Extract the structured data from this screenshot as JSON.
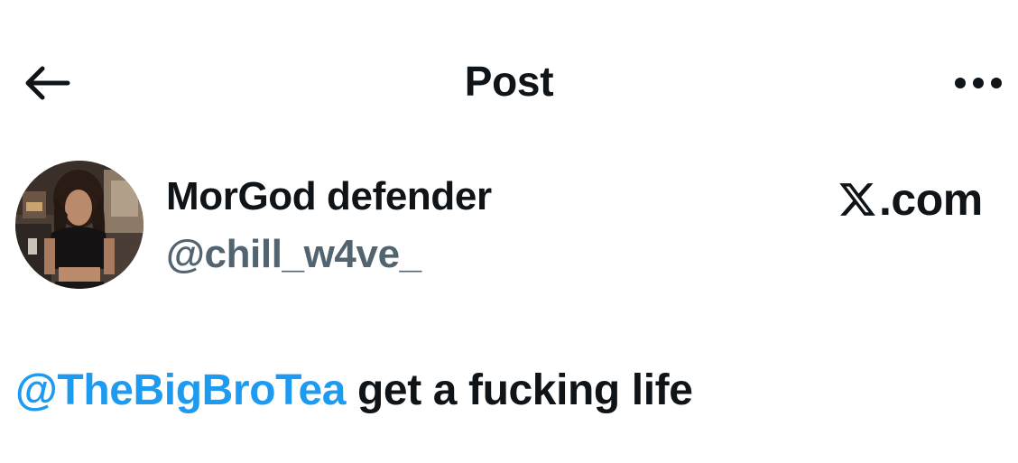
{
  "header": {
    "title": "Post",
    "back_icon": "arrow-left-icon",
    "more_icon": "more-horizontal-icon"
  },
  "author": {
    "display_name": "MorGod defender",
    "handle": "@chill_w4ve_",
    "avatar_icon": "avatar-photo"
  },
  "brand": {
    "logo_icon": "x-logo-icon",
    "suffix": ".com"
  },
  "post": {
    "mention": "@TheBigBroTea",
    "text": " get a fucking life"
  },
  "colors": {
    "text": "#0f1419",
    "secondary": "#536471",
    "accent": "#1d9bf0",
    "background": "#ffffff"
  }
}
